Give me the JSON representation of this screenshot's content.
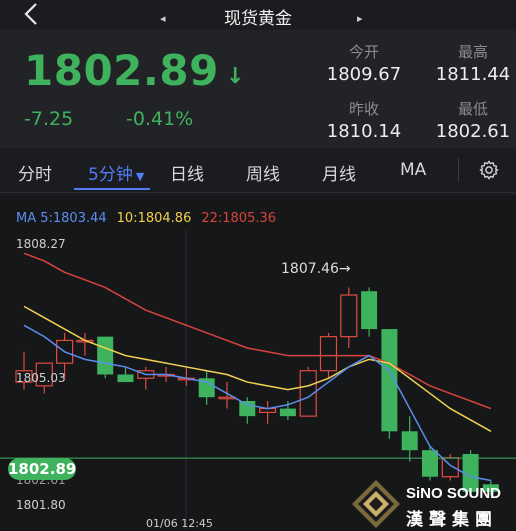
{
  "header": {
    "title": "现货黄金",
    "prev": "◂",
    "next": "▸"
  },
  "quote": {
    "price": "1802.89",
    "direction_icon": "down-arrow-icon",
    "change": "-7.25",
    "change_pct": "-0.41%",
    "up_color": "#3fb25e",
    "stats": {
      "open_label": "今开",
      "open_value": "1809.67",
      "high_label": "最高",
      "high_value": "1811.44",
      "prev_close_label": "昨收",
      "prev_close_value": "1810.14",
      "low_label": "最低",
      "low_value": "1802.61"
    }
  },
  "tabs": [
    {
      "label": "分时"
    },
    {
      "label": "5分钟",
      "active": true
    },
    {
      "label": "日线"
    },
    {
      "label": "周线"
    },
    {
      "label": "月线"
    },
    {
      "label": "MA"
    }
  ],
  "ma": {
    "ma5_label": "MA 5:1803.44",
    "ma10_label": "10:1804.86",
    "ma22_label": "22:1805.36",
    "ma5_color": "#5b8ef0",
    "ma10_color": "#f0d050",
    "ma22_color": "#d8443c"
  },
  "axis": {
    "top": "1808.27",
    "mid": "1805.03",
    "low_partial": "1802.61",
    "bottom": "1801.80"
  },
  "annotations": {
    "high_marker": "1807.46→"
  },
  "price_tag": "1802.89",
  "time_label": "01/06 12:45",
  "logo": {
    "en": "SiNO SOUND",
    "cn": "漢聲集團"
  },
  "chart_data": {
    "type": "candlestick",
    "ylim": [
      1801.6,
      1808.6
    ],
    "candles": [
      {
        "o": 1804.9,
        "h": 1805.7,
        "l": 1804.7,
        "c": 1805.2
      },
      {
        "o": 1804.8,
        "h": 1805.4,
        "l": 1804.6,
        "c": 1805.4
      },
      {
        "o": 1805.4,
        "h": 1806.2,
        "l": 1805.0,
        "c": 1806.0
      },
      {
        "o": 1806.0,
        "h": 1806.2,
        "l": 1805.6,
        "c": 1806.0
      },
      {
        "o": 1806.1,
        "h": 1806.1,
        "l": 1805.0,
        "c": 1805.1
      },
      {
        "o": 1805.1,
        "h": 1805.3,
        "l": 1804.9,
        "c": 1804.9
      },
      {
        "o": 1805.0,
        "h": 1805.3,
        "l": 1804.7,
        "c": 1805.2
      },
      {
        "o": 1805.1,
        "h": 1805.3,
        "l": 1804.9,
        "c": 1805.1
      },
      {
        "o": 1805.0,
        "h": 1805.3,
        "l": 1804.8,
        "c": 1805.0
      },
      {
        "o": 1805.0,
        "h": 1805.2,
        "l": 1804.3,
        "c": 1804.5
      },
      {
        "o": 1804.5,
        "h": 1804.9,
        "l": 1804.2,
        "c": 1804.5
      },
      {
        "o": 1804.4,
        "h": 1804.5,
        "l": 1803.8,
        "c": 1804.0
      },
      {
        "o": 1804.1,
        "h": 1804.4,
        "l": 1803.8,
        "c": 1804.2
      },
      {
        "o": 1804.2,
        "h": 1804.4,
        "l": 1803.9,
        "c": 1804.0
      },
      {
        "o": 1804.0,
        "h": 1805.3,
        "l": 1804.0,
        "c": 1805.2
      },
      {
        "o": 1805.2,
        "h": 1806.2,
        "l": 1805.0,
        "c": 1806.1
      },
      {
        "o": 1806.1,
        "h": 1807.4,
        "l": 1805.8,
        "c": 1807.2
      },
      {
        "o": 1807.3,
        "h": 1807.4,
        "l": 1806.1,
        "c": 1806.3
      },
      {
        "o": 1806.3,
        "h": 1806.3,
        "l": 1803.4,
        "c": 1803.6
      },
      {
        "o": 1803.6,
        "h": 1804.0,
        "l": 1802.8,
        "c": 1803.1
      },
      {
        "o": 1803.1,
        "h": 1803.2,
        "l": 1802.3,
        "c": 1802.4
      },
      {
        "o": 1802.4,
        "h": 1803.0,
        "l": 1802.3,
        "c": 1802.9
      },
      {
        "o": 1803.0,
        "h": 1803.1,
        "l": 1801.9,
        "c": 1802.0
      },
      {
        "o": 1802.2,
        "h": 1802.3,
        "l": 1801.9,
        "c": 1802.0
      }
    ],
    "ma5": [
      1806.4,
      1806.1,
      1805.7,
      1805.5,
      1805.4,
      1805.3,
      1805.1,
      1805.1,
      1805.0,
      1804.9,
      1804.6,
      1804.3,
      1804.2,
      1804.3,
      1804.5,
      1804.9,
      1805.3,
      1805.6,
      1805.2,
      1804.2,
      1803.2,
      1802.7,
      1802.4,
      1802.3
    ],
    "ma10": [
      1806.9,
      1806.6,
      1806.3,
      1806.0,
      1805.8,
      1805.6,
      1805.5,
      1805.4,
      1805.3,
      1805.2,
      1805.1,
      1804.9,
      1804.8,
      1804.7,
      1804.8,
      1805.0,
      1805.3,
      1805.5,
      1805.4,
      1805.0,
      1804.6,
      1804.2,
      1803.9,
      1803.6
    ],
    "ma22": [
      1808.3,
      1808.1,
      1807.8,
      1807.6,
      1807.4,
      1807.1,
      1806.8,
      1806.6,
      1806.4,
      1806.2,
      1806.0,
      1805.8,
      1805.7,
      1805.6,
      1805.6,
      1805.6,
      1805.6,
      1805.6,
      1805.4,
      1805.1,
      1804.8,
      1804.6,
      1804.4,
      1804.2
    ],
    "last_price": 1802.89
  }
}
